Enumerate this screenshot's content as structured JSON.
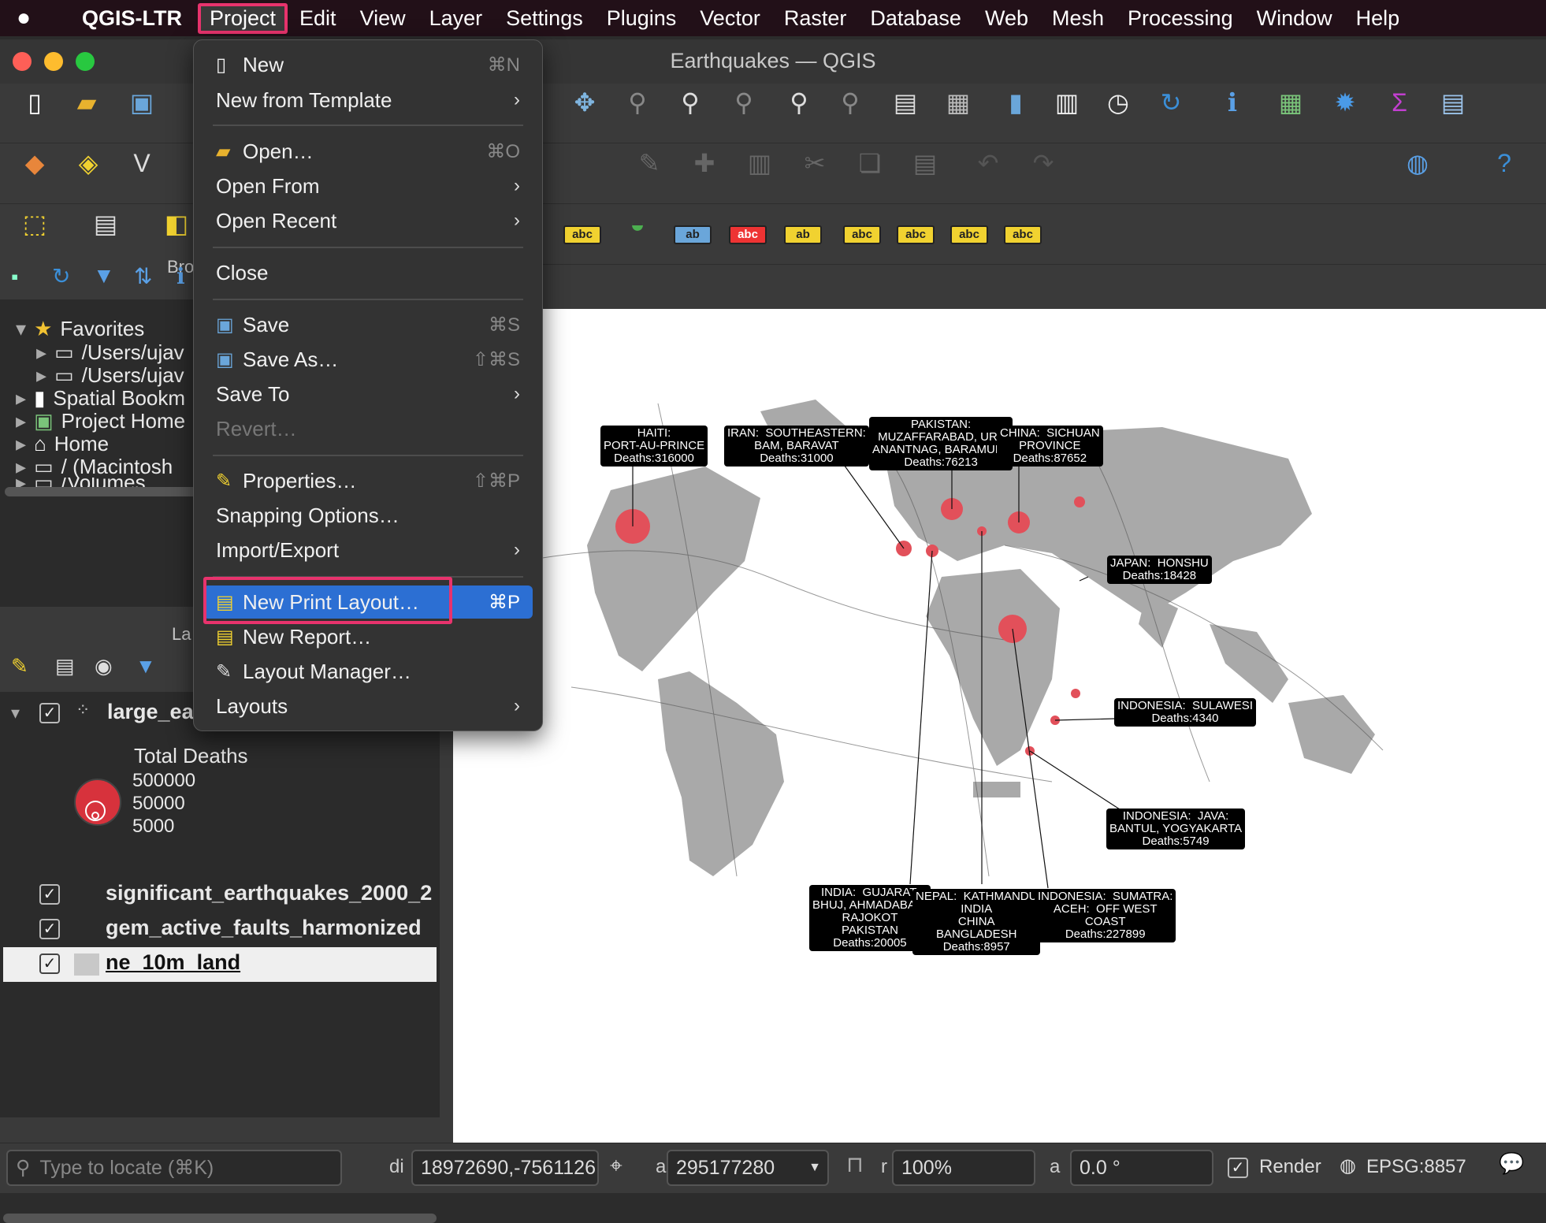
{
  "menubar": {
    "app": "QGIS-LTR",
    "items": [
      "Project",
      "Edit",
      "View",
      "Layer",
      "Settings",
      "Plugins",
      "Vector",
      "Raster",
      "Database",
      "Web",
      "Mesh",
      "Processing",
      "Window",
      "Help"
    ]
  },
  "window": {
    "title": "Earthquakes — QGIS"
  },
  "project_menu": {
    "new": "New",
    "new_sc": "⌘N",
    "new_template": "New from Template",
    "open": "Open…",
    "open_sc": "⌘O",
    "open_from": "Open From",
    "open_recent": "Open Recent",
    "close": "Close",
    "save": "Save",
    "save_sc": "⌘S",
    "save_as": "Save As…",
    "save_as_sc": "⇧⌘S",
    "save_to": "Save To",
    "revert": "Revert…",
    "properties": "Properties…",
    "properties_sc": "⇧⌘P",
    "snapping": "Snapping Options…",
    "import_export": "Import/Export",
    "new_print_layout": "New Print Layout…",
    "new_print_layout_sc": "⌘P",
    "new_report": "New Report…",
    "layout_manager": "Layout Manager…",
    "layouts": "Layouts"
  },
  "browser": {
    "title": "Bro",
    "items": [
      "Favorites",
      "/Users/ujav",
      "/Users/ujav",
      "Spatial Bookm",
      "Project Home",
      "Home",
      "/ (Macintosh",
      "/Volumes"
    ]
  },
  "layers": {
    "title": "La",
    "items": [
      "large_ea",
      "significant_earthquakes_2000_2",
      "gem_active_faults_harmonized",
      "ne_10m_land"
    ],
    "legend_title": "Total Deaths",
    "legend_values": [
      "500000",
      "50000",
      "5000"
    ]
  },
  "map_labels": [
    {
      "text": "HAITI:\nPORT-AU-PRINCE\nDeaths:316000"
    },
    {
      "text": "IRAN:  SOUTHEASTERN:\nBAM, BARAVAT\nDeaths:31000"
    },
    {
      "text": "PAKISTAN:\nMUZAFFARABAD, URI,\nANANTNAG, BARAMULA\nDeaths:76213"
    },
    {
      "text": "CHINA:  SICHUAN\nPROVINCE\nDeaths:87652"
    },
    {
      "text": "JAPAN:  HONSHU\nDeaths:18428"
    },
    {
      "text": "INDONESIA:  SULAWESI\nDeaths:4340"
    },
    {
      "text": "INDONESIA:  JAVA:\nBANTUL, YOGYAKARTA\nDeaths:5749"
    },
    {
      "text": "INDIA:  GUJARAT:\nBHUJ, AHMADABAD,\nRAJOKOT\nPAKISTAN\nDeaths:20005"
    },
    {
      "text": "NEPAL:  KATHMANDU\nINDIA\nCHINA\nBANGLADESH\nDeaths:8957"
    },
    {
      "text": "INDONESIA:  SUMATRA:\nACEH:  OFF WEST\nCOAST\nDeaths:227899"
    }
  ],
  "status": {
    "locate_placeholder": "Type to locate (⌘K)",
    "coord_label": "di",
    "coord": "18972690,-7561126",
    "scale_label": "a",
    "scale": "295177280",
    "mag_label": "r",
    "magnifier": "100%",
    "rot_label": "a",
    "rotation": "0.0 °",
    "render": "Render",
    "crs": "EPSG:8857"
  }
}
